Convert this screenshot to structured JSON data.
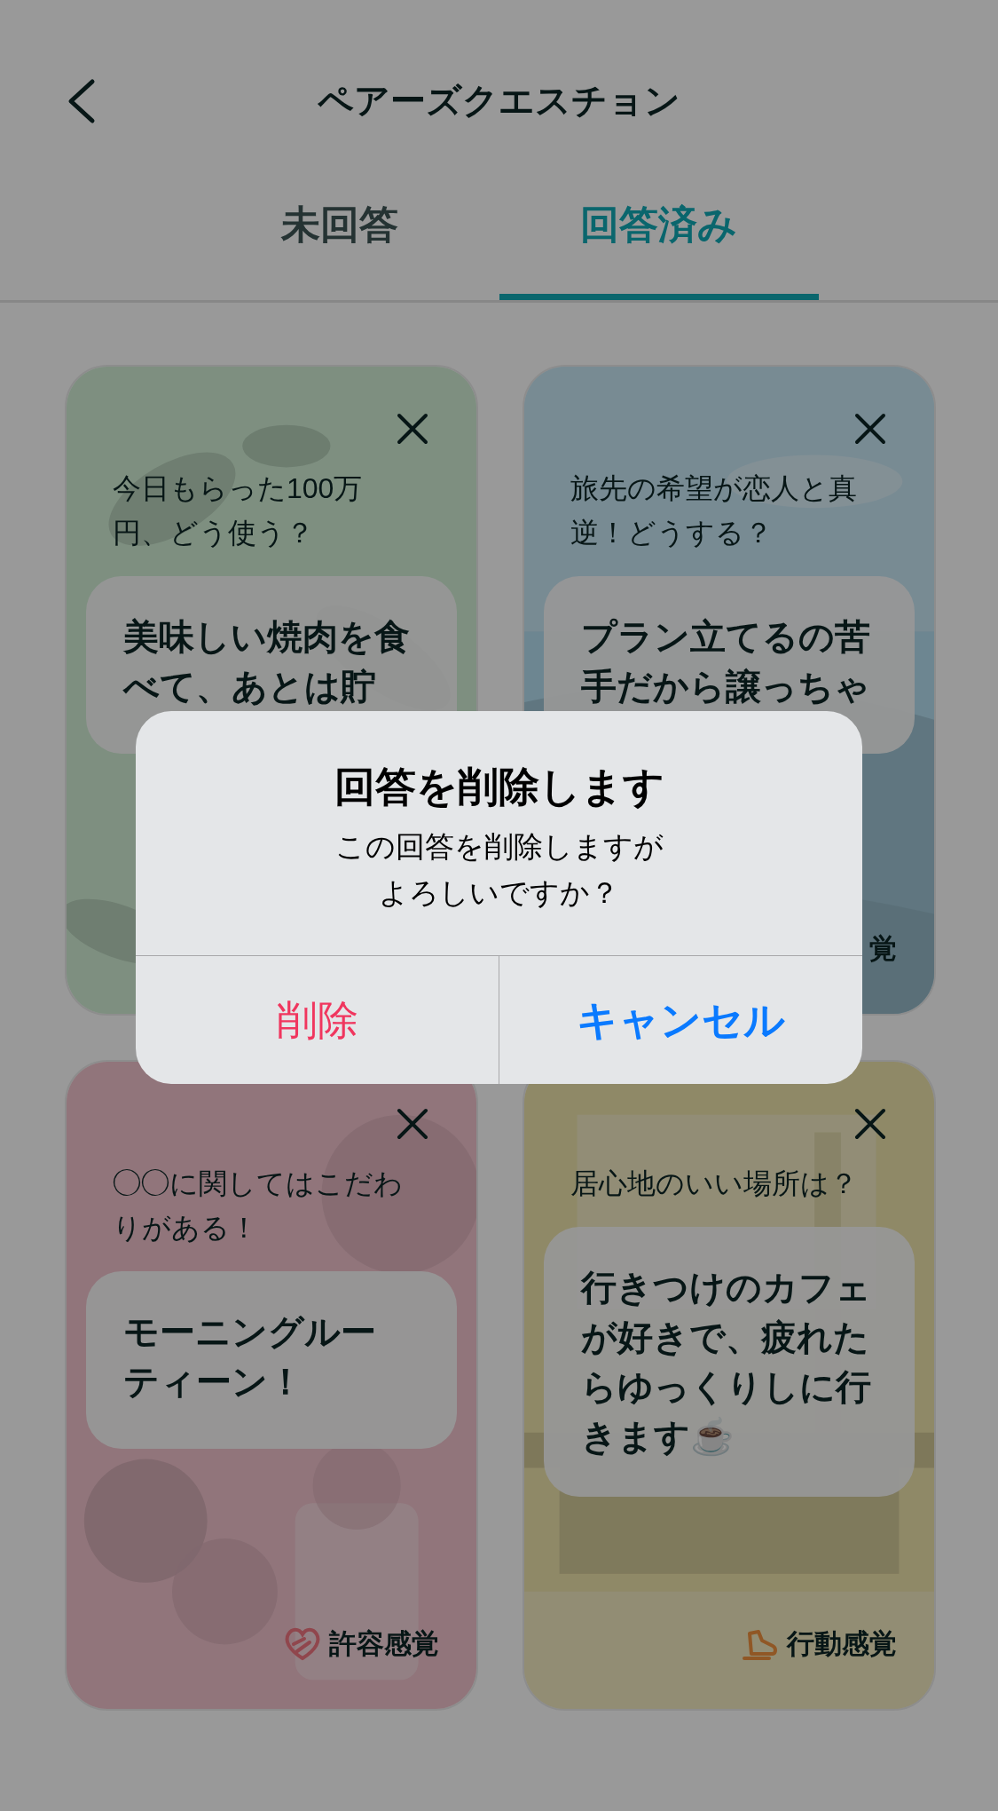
{
  "header": {
    "title": "ペアーズクエスチョン"
  },
  "tabs": [
    {
      "label": "未回答",
      "selected": false
    },
    {
      "label": "回答済み",
      "selected": true
    }
  ],
  "cards": [
    {
      "question": "今日もらった100万円、どう使う？",
      "answer": "美味しい焼肉を食べて、あとは貯"
    },
    {
      "question": "旅先の希望が恋人と真逆！どうする？",
      "answer": "プラン立てるの苦手だから譲っちゃ",
      "badge": {
        "kind": "none",
        "label": "覚"
      }
    },
    {
      "question": "◯◯に関してはこだわりがある！",
      "answer": "モーニングルーティーン！",
      "badge": {
        "kind": "heart",
        "label": "許容感覚"
      }
    },
    {
      "question": "居心地のいい場所は？",
      "answer": "行きつけのカフェが好きで、疲れたらゆっくりしに行きます☕",
      "badge": {
        "kind": "shoe",
        "label": "行動感覚"
      }
    }
  ],
  "dialog": {
    "title": "回答を削除します",
    "message": "この回答を削除しますがよろしいですか？",
    "buttons": [
      {
        "label": "削除",
        "kind": "destructive"
      },
      {
        "label": "キャンセル",
        "kind": "default"
      }
    ]
  }
}
